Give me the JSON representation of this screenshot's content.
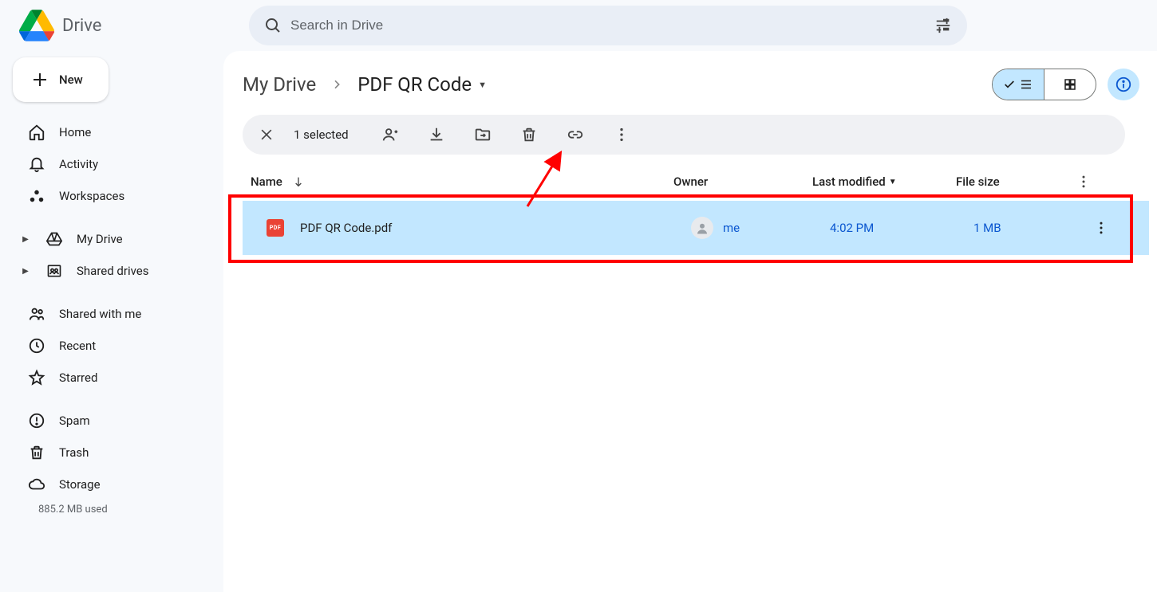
{
  "app_name": "Drive",
  "search": {
    "placeholder": "Search in Drive"
  },
  "new_button_label": "New",
  "nav": {
    "section1": [
      {
        "label": "Home",
        "icon": "home"
      },
      {
        "label": "Activity",
        "icon": "bell"
      },
      {
        "label": "Workspaces",
        "icon": "workspaces"
      }
    ],
    "section2": [
      {
        "label": "My Drive",
        "icon": "drive",
        "expandable": true
      },
      {
        "label": "Shared drives",
        "icon": "shared-drives",
        "expandable": true
      }
    ],
    "section3": [
      {
        "label": "Shared with me",
        "icon": "shared"
      },
      {
        "label": "Recent",
        "icon": "clock"
      },
      {
        "label": "Starred",
        "icon": "star"
      }
    ],
    "section4": [
      {
        "label": "Spam",
        "icon": "spam"
      },
      {
        "label": "Trash",
        "icon": "trash"
      },
      {
        "label": "Storage",
        "icon": "cloud"
      }
    ],
    "storage_used": "885.2 MB used"
  },
  "breadcrumb": {
    "parent": "My Drive",
    "current": "PDF QR Code"
  },
  "selection": {
    "count_text": "1 selected"
  },
  "columns": {
    "name": "Name",
    "owner": "Owner",
    "modified": "Last modified",
    "size": "File size"
  },
  "rows": [
    {
      "file_type": "PDF",
      "name": "PDF QR Code.pdf",
      "owner": "me",
      "modified": "4:02 PM",
      "size": "1 MB",
      "selected": true
    }
  ]
}
